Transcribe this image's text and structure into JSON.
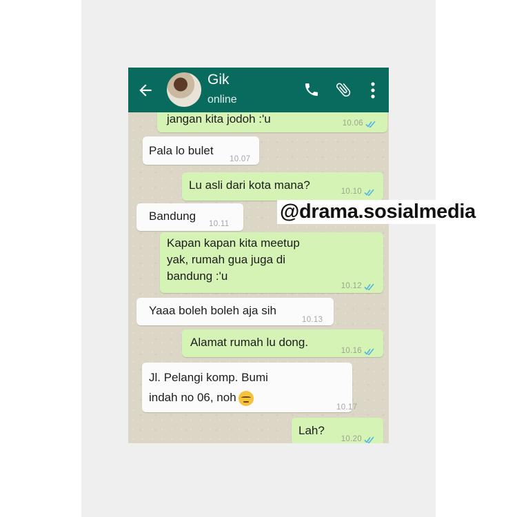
{
  "contact": {
    "name": "Gik",
    "status": "online"
  },
  "icons": {
    "back": "back-arrow-icon",
    "avatar": "avatar-photo",
    "call": "phone-call-icon",
    "attach": "paperclip-icon",
    "menu": "more-vertical-icon",
    "read": "double-check-icon",
    "emoji": "unamused-face-emoji"
  },
  "colors": {
    "header": "#086b5e",
    "incoming": "#fbfbfb",
    "outgoing": "#d5f3b4",
    "read_ticks": "#4fb5e3"
  },
  "messages": [
    {
      "dir": "out",
      "lines": [
        "jangan kita jodoh :'u"
      ],
      "time": "10.06",
      "read": true
    },
    {
      "dir": "in",
      "lines": [
        "Pala lo bulet"
      ],
      "time": "10.07"
    },
    {
      "dir": "out",
      "lines": [
        "Lu asli dari kota mana?"
      ],
      "time": "10.10",
      "read": true
    },
    {
      "dir": "in",
      "lines": [
        "Bandung"
      ],
      "time": "10.11"
    },
    {
      "dir": "out",
      "lines": [
        "Kapan kapan kita meetup",
        "yak, rumah gua juga di",
        "bandung :'u"
      ],
      "time": "10.12",
      "read": true
    },
    {
      "dir": "in",
      "lines": [
        "Yaaa boleh boleh aja sih"
      ],
      "time": "10.13"
    },
    {
      "dir": "out",
      "lines": [
        "Alamat rumah lu dong."
      ],
      "time": "10.16",
      "read": true
    },
    {
      "dir": "in",
      "lines": [
        "Jl. Pelangi komp. Bumi",
        "indah no 06, noh"
      ],
      "time": "10.17",
      "emoji": true
    },
    {
      "dir": "out",
      "lines": [
        "Lah?"
      ],
      "time": "10.20",
      "read": true
    }
  ],
  "watermark": "@drama.sosialmedia"
}
